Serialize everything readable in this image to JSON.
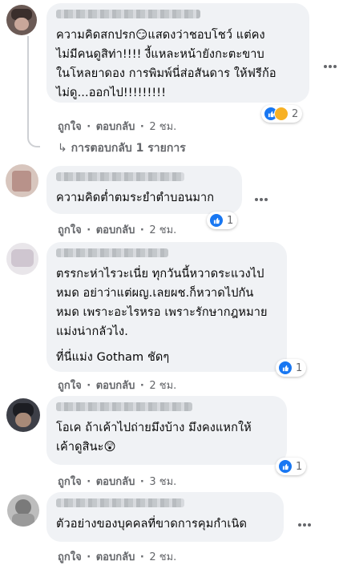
{
  "ui": {
    "like_label": "ถูกใจ",
    "reply_label": "ตอบกลับ",
    "sep": "·",
    "colors": {
      "bubble": "#f0f2f5",
      "meta": "#65676b",
      "like": "#1877f2"
    }
  },
  "comments": [
    {
      "text": "ความคิดสกปรก😏แสดงว่าชอบโชว์ แต่คง\nไม่มีคนดูสิท่า!!!! งี้แหละหน้ายังกะตะขาบ\nในโหลยาดอง การพิมพ์นี่ส่อสันดาร ให้ฟรีก้อ\nไม่ดู...ออกไป!!!!!!!!!",
      "time": "2 ชม.",
      "reaction_count": "2",
      "reaction_icons": [
        "like-icon",
        "care-icon"
      ],
      "replies_link": "การตอบกลับ 1 รายการ"
    },
    {
      "text": "ความคิดต่ำตมระยำตำบอนมาก",
      "time": "2 ชม.",
      "reaction_count": "1",
      "reaction_icons": [
        "like-icon"
      ]
    },
    {
      "text": "ตรรกะห่าไรวะเนี่ย ทุกวันนี้หวาดระแวงไป\nหมด อย่าว่าแต่ผญ.เลยผช.ก็หวาดไปกัน\nหมด เพราะอะไรหรอ เพราะรักษากฎหมาย\nแม่งน่ากลัวไง.",
      "text2": "ที่นี่แม่ง Gotham ชัดๆ",
      "time": "2 ชม.",
      "reaction_count": "1",
      "reaction_icons": [
        "like-icon"
      ]
    },
    {
      "text": "โอเค ถ้าเค้าไปถ่ายมึงบ้าง มึงคงแหกให้\nเค้าดูสินะ😲",
      "time": "3 ชม.",
      "reaction_count": "1",
      "reaction_icons": [
        "like-icon"
      ]
    },
    {
      "text": "ตัวอย่างของบุคคลที่ขาดการคุมกำเนิด",
      "time": "2 ชม.",
      "reaction_count": "",
      "reaction_icons": []
    }
  ]
}
